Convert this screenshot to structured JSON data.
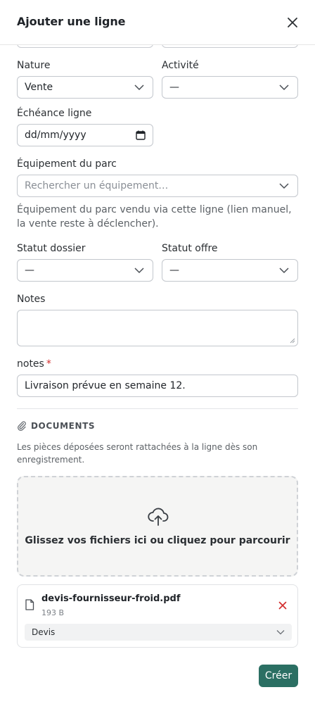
{
  "header": {
    "title": "Ajouter une ligne"
  },
  "form": {
    "nature": {
      "label": "Nature",
      "value": "Vente"
    },
    "activite": {
      "label": "Activité",
      "value": "—"
    },
    "echeance": {
      "label": "Échéance ligne",
      "value": "dd/mm/yyyy"
    },
    "equipement": {
      "label": "Équipement du parc",
      "placeholder": "Rechercher un équipement…",
      "help": "Équipement du parc vendu via cette ligne (lien manuel, la vente reste à déclencher)."
    },
    "statut_dossier": {
      "label": "Statut dossier",
      "value": "—"
    },
    "statut_offre": {
      "label": "Statut offre",
      "value": "—"
    },
    "notes_area": {
      "label": "Notes",
      "value": ""
    },
    "notes_field": {
      "label": "notes",
      "required_mark": "*",
      "value": "Livraison prévue en semaine 12."
    }
  },
  "documents": {
    "heading": "DOCUMENTS",
    "description": "Les pièces déposées seront rattachées à la ligne dès son enregistrement.",
    "dropzone_text": "Glissez vos fichiers ici ou cliquez pour parcourir",
    "files": [
      {
        "name": "devis-fournisseur-froid.pdf",
        "size": "193 B",
        "type": "Devis"
      }
    ]
  },
  "footer": {
    "create_label": "Créer"
  },
  "colors": {
    "primary": "#2b6f63",
    "danger": "#d32f2f",
    "border": "#c3c7cd"
  },
  "icons": {
    "close": "close-icon",
    "chevron": "chevron-down-icon",
    "calendar": "calendar-icon",
    "paperclip": "paperclip-icon",
    "upload": "cloud-upload-icon",
    "file": "file-icon",
    "remove": "remove-x-icon"
  }
}
